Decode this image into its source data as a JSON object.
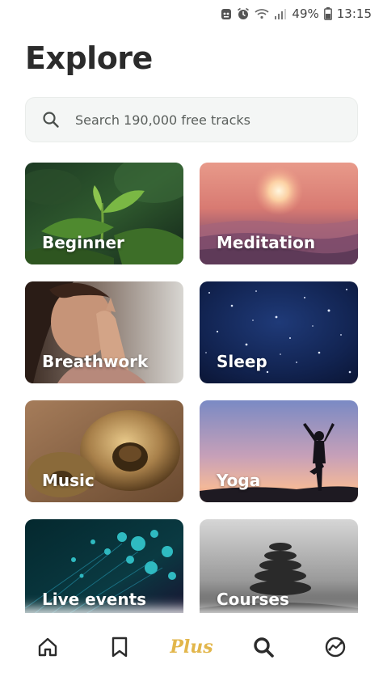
{
  "status_bar": {
    "battery": "49%",
    "time": "13:15"
  },
  "title": "Explore",
  "search": {
    "placeholder": "Search 190,000 free tracks"
  },
  "categories": [
    {
      "label": "Beginner"
    },
    {
      "label": "Meditation"
    },
    {
      "label": "Breathwork"
    },
    {
      "label": "Sleep"
    },
    {
      "label": "Music"
    },
    {
      "label": "Yoga"
    },
    {
      "label": "Live events"
    },
    {
      "label": "Courses"
    }
  ],
  "bottom_nav": {
    "items": [
      "home-icon",
      "bookmark-icon",
      "plus",
      "search-icon",
      "discover-icon"
    ],
    "plus_label": "Plus",
    "active_color": "#2b2b2b",
    "plus_color": "#e2b64b"
  }
}
